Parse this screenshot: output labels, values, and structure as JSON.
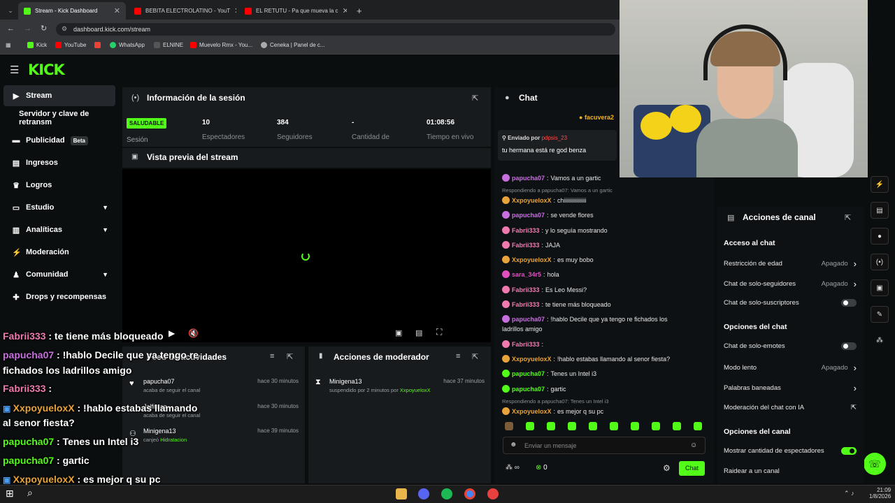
{
  "browser": {
    "tabs": [
      {
        "title": "Stream - Kick Dashboard",
        "color": "#53fc18"
      },
      {
        "title": "BEBITA ELECTROLATINO - YouT",
        "color": "#ff0000"
      },
      {
        "title": "EL RETUTU - Pa que mueva la c",
        "color": "#ff0000"
      }
    ],
    "new_tab": "+",
    "url": "dashboard.kick.com/stream",
    "bookmarks": [
      {
        "label": "Kick",
        "color": "#53fc18"
      },
      {
        "label": "YouTube",
        "color": "#ff0000"
      },
      {
        "label": "",
        "color": "#ea4335"
      },
      {
        "label": "WhatsApp",
        "color": "#25d366"
      },
      {
        "label": "ELNINE",
        "color": "#444"
      },
      {
        "label": "Muevelo Rmx - You...",
        "color": "#ff0000"
      },
      {
        "label": "Ceneka | Panel de c...",
        "color": "#aaa"
      }
    ]
  },
  "logo": "KICK",
  "sidebar": {
    "items": [
      {
        "label": "Stream",
        "icon": "▶"
      },
      {
        "label": "Servidor y clave de retransm",
        "icon": ""
      },
      {
        "label": "Publicidad",
        "icon": "▬",
        "badge": "Beta"
      },
      {
        "label": "Ingresos",
        "icon": "▤"
      },
      {
        "label": "Logros",
        "icon": "♛"
      },
      {
        "label": "Estudio",
        "icon": "▭"
      },
      {
        "label": "Analíticas",
        "icon": "▥"
      },
      {
        "label": "Moderación",
        "icon": "⚡"
      },
      {
        "label": "Comunidad",
        "icon": "♟"
      },
      {
        "label": "Drops y recompensas",
        "icon": "✚"
      }
    ]
  },
  "session": {
    "title": "Información de la sesión",
    "health": "SALUDABLE",
    "health_label": "Sesión",
    "stats": [
      {
        "value": "10",
        "label": "Espectadores"
      },
      {
        "value": "384",
        "label": "Seguidores"
      },
      {
        "value": "-",
        "label": "Cantidad de"
      },
      {
        "value": "01:08:56",
        "label": "Tiempo en vivo"
      }
    ]
  },
  "preview": {
    "title": "Vista previa del stream"
  },
  "activity": {
    "title": "Feed de actividades",
    "items": [
      {
        "user": "papucha07",
        "sub": "acaba de seguir el canal",
        "time": "hace 30 minutos"
      },
      {
        "user": "Jalfitaaa",
        "sub": "acaba de seguir el canal",
        "time": "hace 30 minutos"
      },
      {
        "user": "Minigena13",
        "sub": "canjeó",
        "reward": "Hidratacion",
        "time": "hace 39 minutos"
      }
    ]
  },
  "mod_actions": {
    "title": "Acciones de moderador",
    "items": [
      {
        "user": "Minigena13",
        "sub": "suspendido por 2 minutos por",
        "by": "XxpoyueloxX",
        "time": "hace 37 minutos"
      }
    ]
  },
  "chat": {
    "title": "Chat",
    "top_user": "facuvera2",
    "pinned_label": "Enviado por",
    "pinned_user": "pdpsis_23",
    "pinned_msg": "tu hermana está re god benza",
    "messages": [
      {
        "user": "papucha07",
        "text": "Vamos a un gartic",
        "color": "#c86fe0"
      },
      {
        "reply": "Respondiendo a papucha07: Vamos a un gartic"
      },
      {
        "user": "XxpoyueloxX",
        "text": "chiiiiiiiiiiiiiiii",
        "color": "#e8a33a"
      },
      {
        "user": "papucha07",
        "text": "se vende flores",
        "color": "#c86fe0"
      },
      {
        "user": "Fabrii333",
        "text": "y lo seguía mostrando",
        "color": "#f07ab0"
      },
      {
        "user": "Fabrii333",
        "text": "JAJA",
        "color": "#f07ab0"
      },
      {
        "user": "XxpoyueloxX",
        "text": "es muy bobo",
        "color": "#e8a33a"
      },
      {
        "user": "sara_34r5",
        "text": "hola",
        "color": "#e050c0"
      },
      {
        "user": "Fabrii333",
        "text": "Es Leo Messi?",
        "color": "#f07ab0"
      },
      {
        "user": "Fabrii333",
        "text": "te tiene más bloqueado",
        "color": "#f07ab0"
      },
      {
        "user": "papucha07",
        "text": "!hablo Decile que ya tengo re fichados los",
        "color": "#c86fe0"
      },
      {
        "cont": "ladrillos amigo"
      },
      {
        "user": "Fabrii333",
        "text": "",
        "color": "#f07ab0"
      },
      {
        "user": "XxpoyueloxX",
        "text": "!hablo estabas llamando al senor fiesta?",
        "color": "#e8a33a"
      },
      {
        "user": "papucha07",
        "text": "Tenes un Intel i3",
        "color": "#53fc18"
      },
      {
        "user": "papucha07",
        "text": "gartic",
        "color": "#53fc18"
      },
      {
        "reply": "Respondiendo a papucha07: Tenes un Intel i3"
      },
      {
        "user": "XxpoyueloxX",
        "text": "es mejor q su pc",
        "color": "#e8a33a"
      }
    ],
    "input_placeholder": "Enviar un mensaje",
    "infinity": "∞",
    "points": "0",
    "send": "Chat"
  },
  "channel_actions": {
    "title": "Acciones de canal",
    "sections": [
      {
        "header": "Acceso al chat"
      },
      {
        "label": "Restricción de edad",
        "value": "Apagado",
        "type": "arrow"
      },
      {
        "label": "Chat de solo-seguidores",
        "value": "Apagado",
        "type": "arrow"
      },
      {
        "label": "Chat de solo-suscriptores",
        "type": "toggle",
        "on": false
      },
      {
        "header": "Opciones del chat"
      },
      {
        "label": "Chat de solo-emotes",
        "type": "toggle",
        "on": false
      },
      {
        "label": "Modo lento",
        "value": "Apagado",
        "type": "arrow"
      },
      {
        "label": "Palabras baneadas",
        "type": "arrow"
      },
      {
        "label": "Moderación del chat con IA",
        "type": "ext"
      },
      {
        "header": "Opciones del canal"
      },
      {
        "label": "Mostrar cantidad de espectadores",
        "type": "toggle",
        "on": true
      },
      {
        "label": "Raidear a un canal",
        "type": "none"
      }
    ]
  },
  "overlay_chat": [
    {
      "user": "Fabrii333",
      "text": " : te tiene más bloqueado",
      "color": "#f07ab0"
    },
    {
      "user": "papucha07",
      "text": " : !hablo Decile que ya tengo re",
      "color": "#c86fe0"
    },
    {
      "user": "",
      "text": "fichados los ladrillos amigo",
      "color": "#fff"
    },
    {
      "user": "Fabrii333",
      "text": " : ",
      "color": "#f07ab0"
    },
    {
      "user": "XxpoyueloxX",
      "text": " : !hablo estabas llamando",
      "color": "#e8a33a",
      "badge": true
    },
    {
      "user": "",
      "text": "al senor fiesta?",
      "color": "#fff"
    },
    {
      "user": "papucha07",
      "text": " : Tenes un Intel i3",
      "color": "#53fc18"
    },
    {
      "user": "papucha07",
      "text": " : gartic",
      "color": "#53fc18"
    },
    {
      "user": "XxpoyueloxX",
      "text": " : es mejor q su pc",
      "color": "#e8a33a",
      "badge": true
    }
  ],
  "taskbar": {
    "time": "21:09",
    "date": "1/8/2026"
  }
}
